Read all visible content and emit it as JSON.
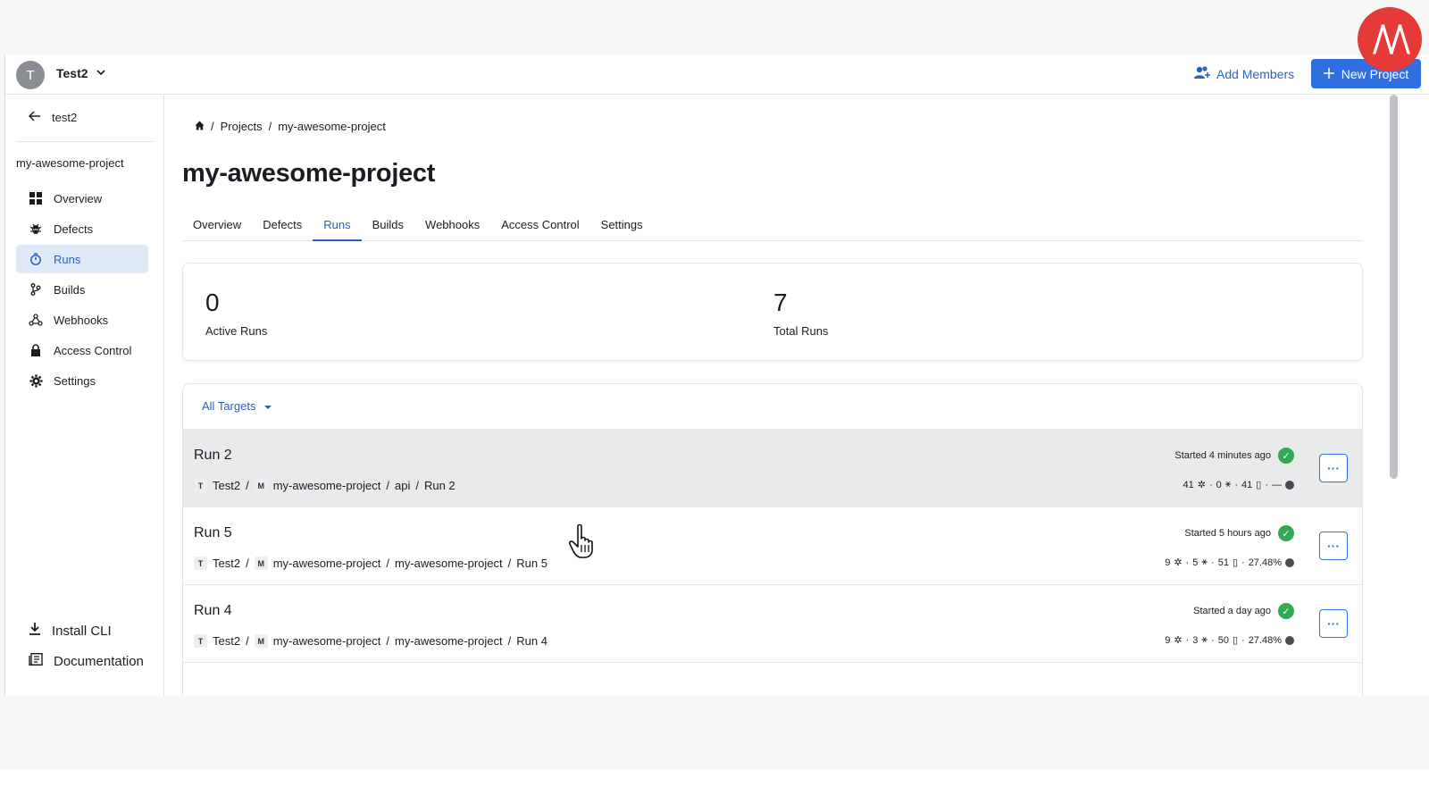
{
  "topbar": {
    "org_initial": "T",
    "org_name": "Test2",
    "add_members_label": "Add Members",
    "new_project_label": "New Project"
  },
  "sidebar": {
    "back_label": "test2",
    "project_name": "my-awesome-project",
    "items": [
      {
        "label": "Overview",
        "icon": "grid-icon"
      },
      {
        "label": "Defects",
        "icon": "bug-icon"
      },
      {
        "label": "Runs",
        "icon": "stopwatch-icon",
        "active": true
      },
      {
        "label": "Builds",
        "icon": "git-branch-icon"
      },
      {
        "label": "Webhooks",
        "icon": "webhook-icon"
      },
      {
        "label": "Access Control",
        "icon": "lock-icon"
      },
      {
        "label": "Settings",
        "icon": "gear-icon"
      }
    ],
    "install_cli": "Install CLI",
    "documentation": "Documentation"
  },
  "breadcrumb": {
    "projects": "Projects",
    "separator": "/",
    "current": "my-awesome-project"
  },
  "page_title": "my-awesome-project",
  "tabs": [
    "Overview",
    "Defects",
    "Runs",
    "Builds",
    "Webhooks",
    "Access Control",
    "Settings"
  ],
  "active_tab": "Runs",
  "stats": {
    "active_runs_value": "0",
    "active_runs_label": "Active Runs",
    "total_runs_value": "7",
    "total_runs_label": "Total Runs"
  },
  "filter": {
    "label": "All Targets"
  },
  "runs": [
    {
      "name": "Run 2",
      "org_chip": "T",
      "org": "Test2",
      "project_chip": "M",
      "project": "my-awesome-project",
      "target": "api",
      "run": "Run 2",
      "started": "Started 4 minutes ago",
      "defects": "41",
      "ignored": "0",
      "tests": "41",
      "coverage": "—"
    },
    {
      "name": "Run 5",
      "org_chip": "T",
      "org": "Test2",
      "project_chip": "M",
      "project": "my-awesome-project",
      "target": "my-awesome-project",
      "run": "Run 5",
      "started": "Started 5 hours ago",
      "defects": "9",
      "ignored": "5",
      "tests": "51",
      "coverage": "27.48%"
    },
    {
      "name": "Run 4",
      "org_chip": "T",
      "org": "Test2",
      "project_chip": "M",
      "project": "my-awesome-project",
      "target": "my-awesome-project",
      "run": "Run 4",
      "started": "Started a day ago",
      "defects": "9",
      "ignored": "3",
      "tests": "50",
      "coverage": "27.48%"
    }
  ],
  "colors": {
    "accent": "#2f6fe0",
    "active_nav_bg": "#dfeaf8",
    "success": "#34a853",
    "brand_badge": "#e63a38"
  }
}
